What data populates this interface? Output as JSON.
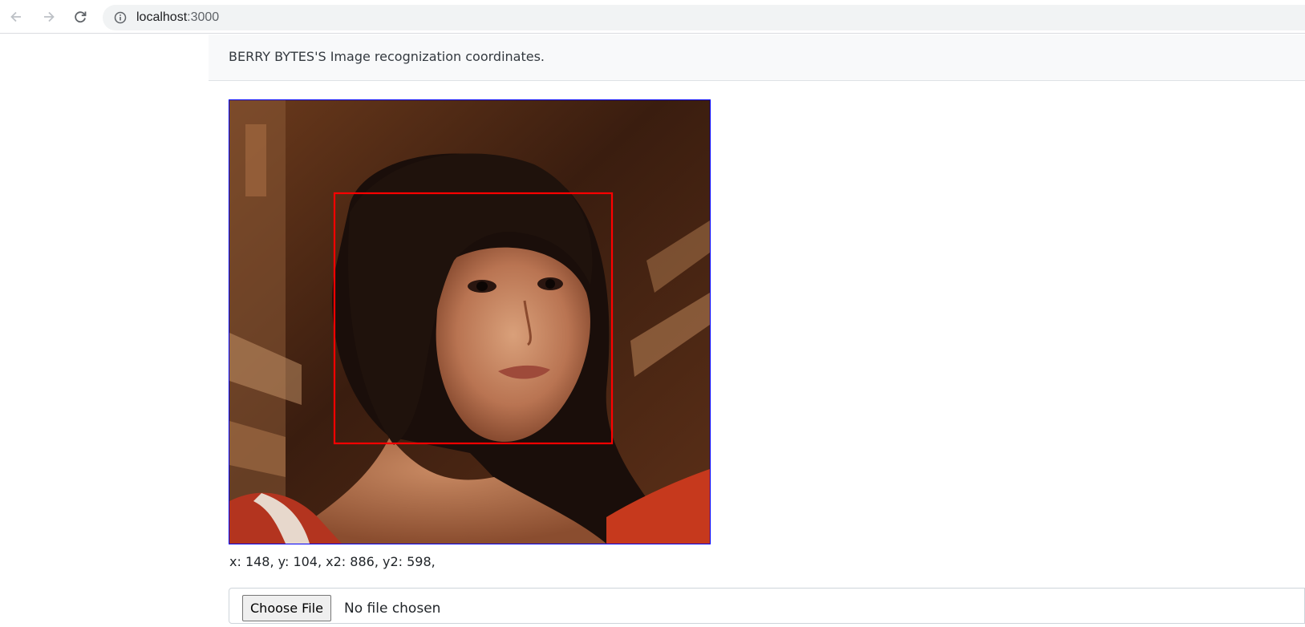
{
  "browser": {
    "url_host": "localhost",
    "url_port": ":3000",
    "icons": {
      "back": "back-arrow-icon",
      "forward": "forward-arrow-icon",
      "reload": "reload-icon",
      "site_info": "info-icon"
    }
  },
  "navbar": {
    "brand": "BERRY BYTES'S Image recognization coordinates."
  },
  "detection": {
    "photo_subject": "face photo",
    "box_color": "#ff0000",
    "frame_color": "#0000ff",
    "coordinates_text": "x: 148, y: 104, x2: 886, y2: 598,"
  },
  "file_input": {
    "button_label": "Choose File",
    "status": "No file chosen"
  }
}
